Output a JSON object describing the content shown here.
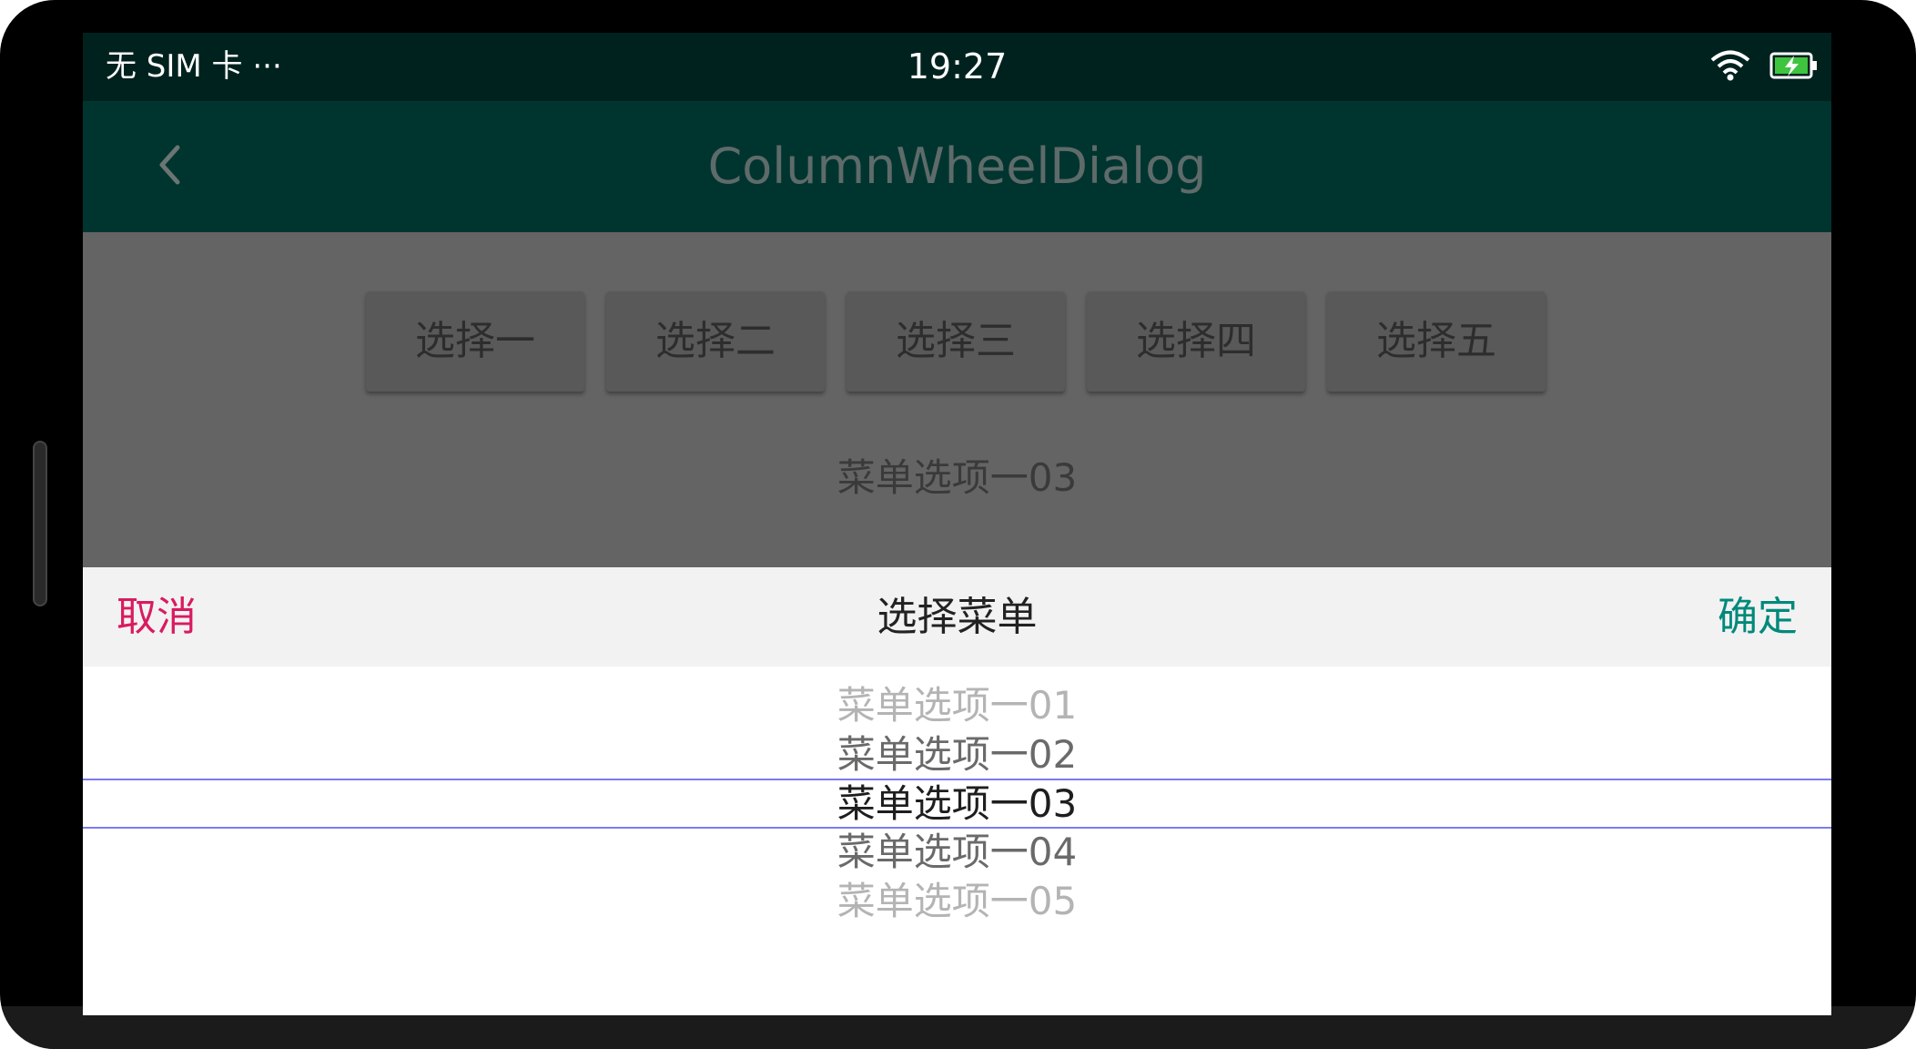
{
  "status_bar": {
    "carrier": "无 SIM 卡 ···",
    "time": "19:27",
    "icons": [
      "wifi-icon",
      "battery-charging-icon"
    ]
  },
  "app_bar": {
    "title": "ColumnWheelDialog",
    "back_icon": "chevron-left-icon"
  },
  "content": {
    "buttons": [
      "选择一",
      "选择二",
      "选择三",
      "选择四",
      "选择五"
    ],
    "selected_text": "菜单选项一03"
  },
  "dialog": {
    "cancel_label": "取消",
    "title": "选择菜单",
    "confirm_label": "确定",
    "items": [
      "菜单选项一01",
      "菜单选项一02",
      "菜单选项一03",
      "菜单选项一04",
      "菜单选项一05"
    ],
    "selected_index": 2
  },
  "colors": {
    "status_bar": "#00221e",
    "app_bar": "#00352f",
    "overlay": "#646464",
    "cancel": "#d81b60",
    "confirm": "#00897b",
    "divider": "#7b7bf0"
  }
}
